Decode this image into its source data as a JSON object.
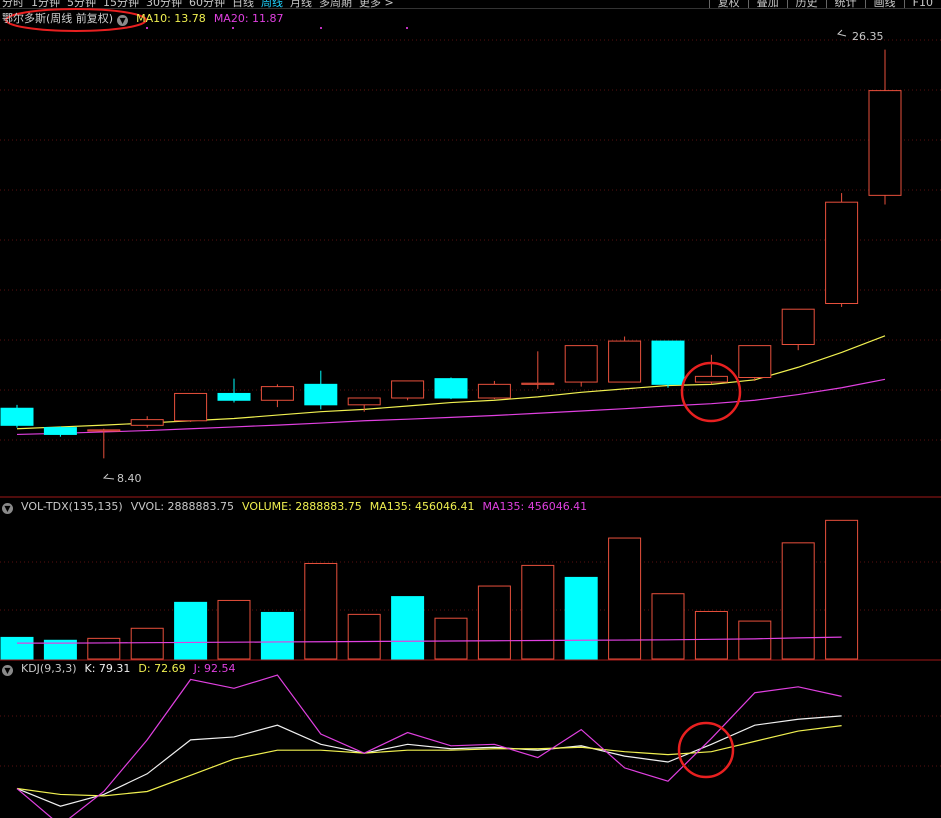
{
  "toolbar": {
    "tabs": [
      "分时",
      "1分钟",
      "5分钟",
      "15分钟",
      "30分钟",
      "60分钟",
      "日线",
      "周线",
      "月线",
      "多周期",
      "更多 >"
    ],
    "active_tab": "周线",
    "right_buttons": [
      "复权",
      "叠加",
      "历史",
      "统计",
      "画线",
      "F10"
    ]
  },
  "main_legend": {
    "title": "鄂尔多斯(周线 前复权)",
    "ma10": "MA10: 13.78",
    "ma20": "MA20: 11.87",
    "max_label": "26.35",
    "min_label": "8.40",
    "colors": {
      "ma10": "#f0f050",
      "ma20": "#e040e0"
    }
  },
  "vol_legend": {
    "name": "VOL-TDX(135,135)",
    "vvol": "VVOL: 2888883.75",
    "volume": "VOLUME: 2888883.75",
    "ma135a": "MA135: 456046.41",
    "ma135b": "MA135: 456046.41"
  },
  "kdj_legend": {
    "name": "KDJ(9,3,3)",
    "k": "K: 79.31",
    "d": "D: 72.69",
    "j": "J: 92.54"
  },
  "chart_data": [
    {
      "type": "candlestick",
      "title": "鄂尔多斯(周线 前复权)",
      "ylim": [
        7.8,
        27.3
      ],
      "candles": [
        {
          "o": 10.6,
          "h": 10.75,
          "c": 9.85,
          "l": 9.75
        },
        {
          "o": 9.75,
          "h": 9.8,
          "c": 9.45,
          "l": 9.35
        },
        {
          "o": 9.6,
          "h": 9.7,
          "c": 9.65,
          "l": 8.4
        },
        {
          "o": 9.85,
          "h": 10.25,
          "c": 10.1,
          "l": 9.75
        },
        {
          "o": 10.05,
          "h": 11.25,
          "c": 11.25,
          "l": 10.0
        },
        {
          "o": 11.25,
          "h": 11.9,
          "c": 10.95,
          "l": 10.85
        },
        {
          "o": 10.95,
          "h": 11.65,
          "c": 11.55,
          "l": 10.65
        },
        {
          "o": 11.65,
          "h": 12.25,
          "c": 10.75,
          "l": 10.55
        },
        {
          "o": 10.75,
          "h": 11.05,
          "c": 11.05,
          "l": 10.45
        },
        {
          "o": 11.05,
          "h": 11.8,
          "c": 11.8,
          "l": 10.95
        },
        {
          "o": 11.9,
          "h": 11.95,
          "c": 11.05,
          "l": 11.0
        },
        {
          "o": 11.05,
          "h": 11.8,
          "c": 11.65,
          "l": 11.0
        },
        {
          "o": 11.65,
          "h": 13.1,
          "c": 11.7,
          "l": 11.45
        },
        {
          "o": 11.75,
          "h": 13.35,
          "c": 13.35,
          "l": 11.55
        },
        {
          "o": 11.75,
          "h": 13.75,
          "c": 13.55,
          "l": 11.75
        },
        {
          "o": 13.55,
          "h": 13.1,
          "c": 11.65,
          "l": 11.5
        },
        {
          "o": 11.75,
          "h": 12.95,
          "c": 12.0,
          "l": 11.65
        },
        {
          "o": 11.95,
          "h": 13.35,
          "c": 13.35,
          "l": 11.8
        },
        {
          "o": 13.4,
          "h": 14.95,
          "c": 14.95,
          "l": 13.15
        },
        {
          "o": 15.2,
          "h": 20.05,
          "c": 19.65,
          "l": 15.05
        },
        {
          "o": 19.95,
          "h": 26.35,
          "c": 24.55,
          "l": 19.55
        }
      ],
      "ma10": [
        9.7,
        9.78,
        9.86,
        9.95,
        10.05,
        10.15,
        10.3,
        10.45,
        10.55,
        10.7,
        10.85,
        10.95,
        11.1,
        11.3,
        11.45,
        11.6,
        11.65,
        11.85,
        12.4,
        13.05,
        13.78
      ],
      "ma20": [
        9.45,
        9.5,
        9.56,
        9.62,
        9.7,
        9.78,
        9.86,
        9.95,
        10.05,
        10.12,
        10.2,
        10.28,
        10.38,
        10.48,
        10.58,
        10.7,
        10.8,
        10.95,
        11.2,
        11.5,
        11.87
      ]
    },
    {
      "type": "bar",
      "title": "VOL-TDX(135,135)",
      "ylim": [
        0,
        3000000
      ],
      "values": [
        450000,
        390000,
        430000,
        640000,
        1180000,
        1220000,
        970000,
        1990000,
        930000,
        1300000,
        850000,
        1520000,
        1950000,
        1700000,
        2520000,
        1360000,
        990000,
        790000,
        2420000,
        2888883.75
      ],
      "bullish": [
        false,
        false,
        true,
        true,
        false,
        true,
        false,
        true,
        true,
        false,
        true,
        true,
        true,
        false,
        true,
        true,
        true,
        true,
        true,
        true
      ],
      "ma135": [
        330000,
        330000,
        335000,
        340000,
        345000,
        350000,
        355000,
        360000,
        365000,
        370000,
        375000,
        380000,
        385000,
        390000,
        395000,
        400000,
        410000,
        420000,
        440000,
        456046.41
      ]
    },
    {
      "type": "line",
      "title": "KDJ(9,3,3)",
      "ylim": [
        10,
        105
      ],
      "series": [
        {
          "name": "K",
          "values": [
            30,
            18,
            26,
            40,
            63,
            65,
            73,
            60,
            54,
            60,
            57,
            58,
            56,
            59,
            52,
            48,
            60,
            73,
            77,
            79.31
          ]
        },
        {
          "name": "D",
          "values": [
            30,
            26,
            25,
            28,
            39,
            50,
            56,
            56,
            54,
            56,
            56,
            57,
            57,
            58,
            55,
            53,
            55,
            62,
            69,
            72.69
          ]
        },
        {
          "name": "J",
          "values": [
            30,
            5,
            28,
            63,
            104,
            98,
            107,
            67,
            54,
            68,
            59,
            60,
            51,
            70,
            44,
            35,
            64,
            95,
            99,
            92.54
          ]
        }
      ]
    }
  ]
}
